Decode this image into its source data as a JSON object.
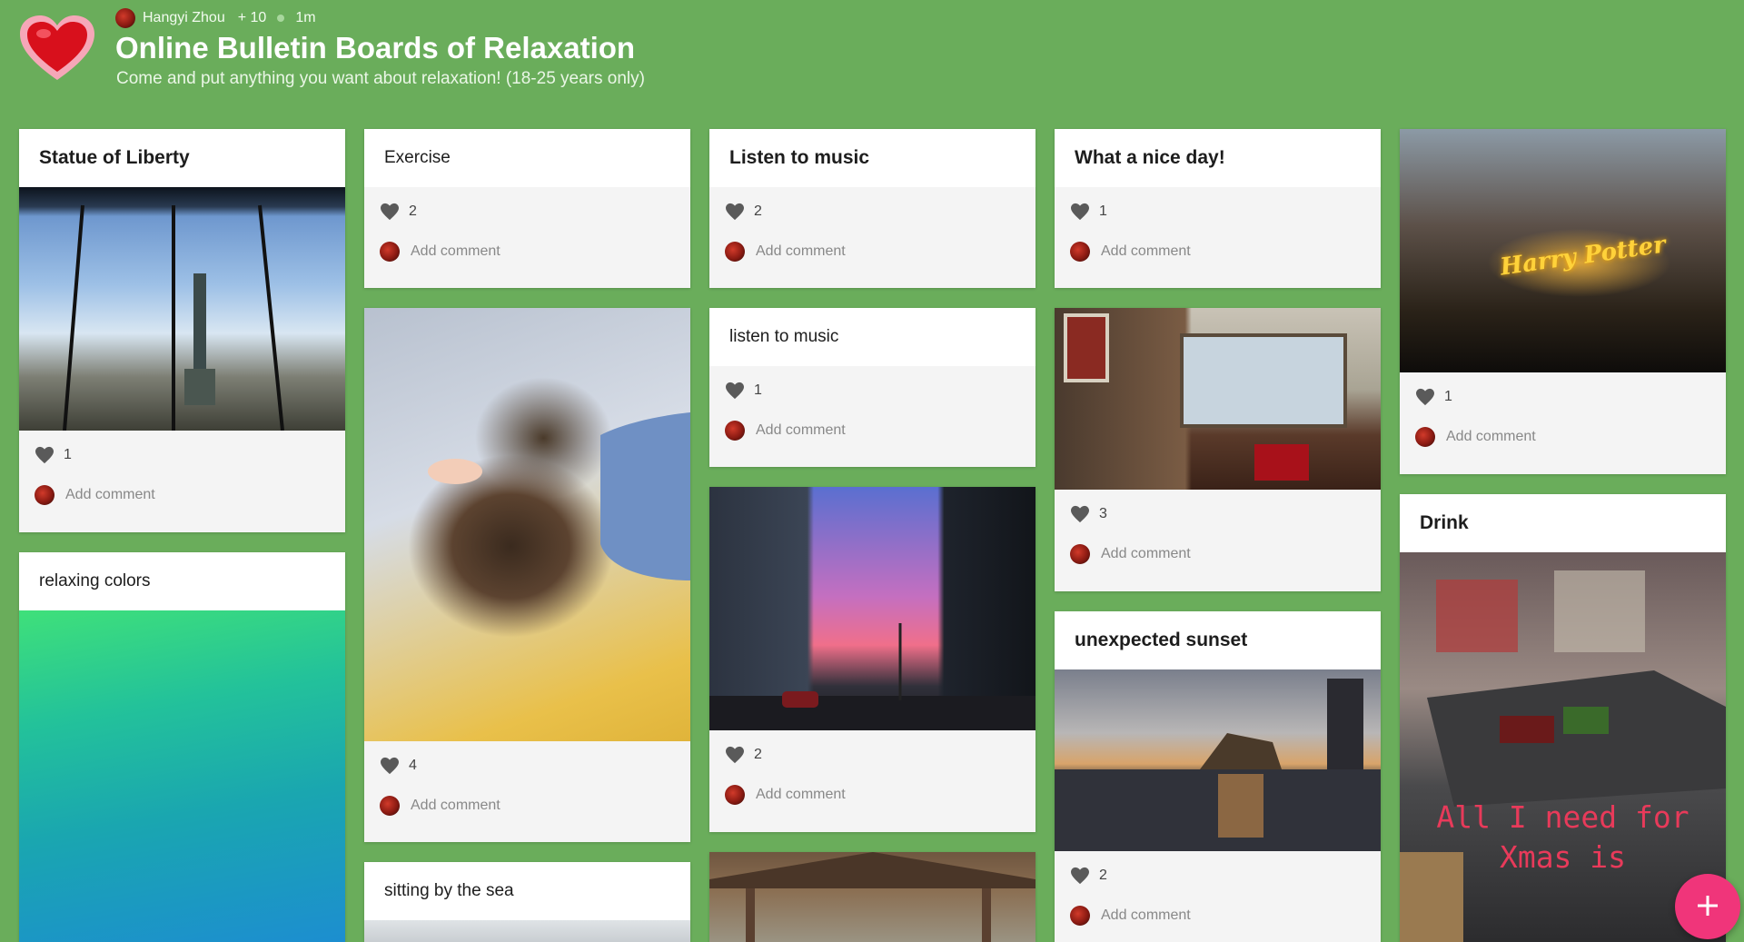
{
  "header": {
    "author": "Hangyi Zhou",
    "contributors": "+ 10",
    "time": "1m",
    "title": "Online Bulletin Boards of Relaxation",
    "subtitle": "Come and put anything you want about relaxation! (18-25 years only)"
  },
  "comment_placeholder": "Add comment",
  "colors": {
    "background": "#6aad5b",
    "fab": "#f0357a"
  },
  "posts": [
    {
      "title": "Statue of Liberty",
      "likes": "1"
    },
    {
      "title": "relaxing colors"
    },
    {
      "title": "Exercise",
      "likes": "2"
    },
    {
      "likes": "4"
    },
    {
      "title": "sitting by the sea"
    },
    {
      "title": "Listen to music",
      "likes": "2"
    },
    {
      "title": "listen to music",
      "likes": "1"
    },
    {
      "likes": "2"
    },
    {
      "title": "What a nice day!",
      "likes": "1"
    },
    {
      "likes": "3"
    },
    {
      "title": "unexpected sunset",
      "likes": "2"
    },
    {
      "likes": "1",
      "image_text": "Harry Potter"
    },
    {
      "title": "Drink",
      "image_text": [
        "All I need for",
        "Xmas is"
      ]
    }
  ],
  "fab": {
    "icon": "plus-icon"
  }
}
